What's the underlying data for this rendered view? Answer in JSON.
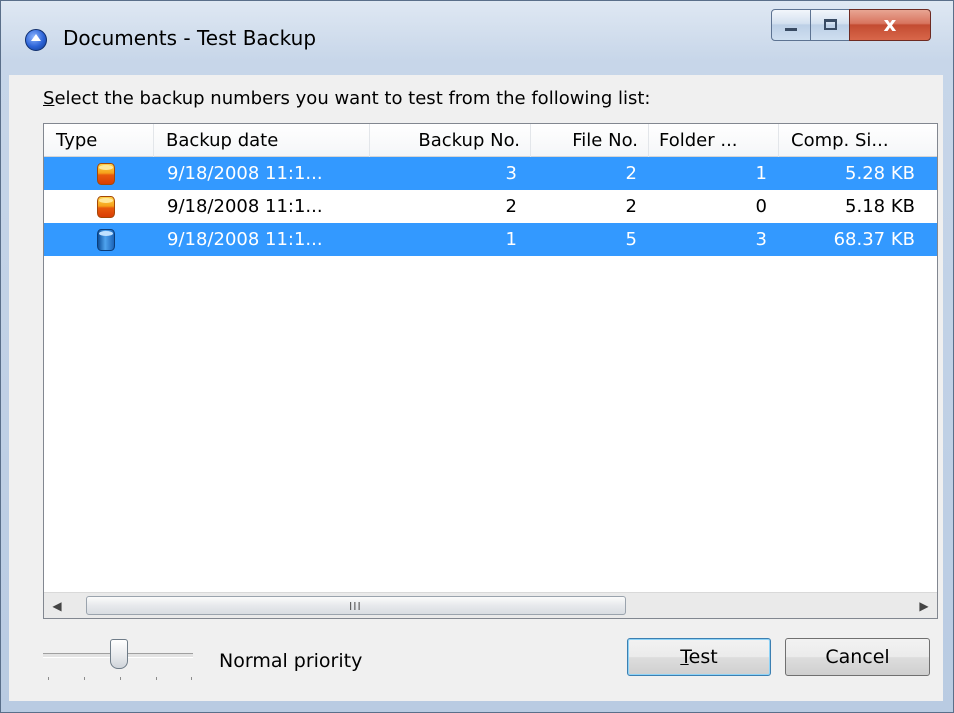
{
  "window": {
    "title": "Documents - Test Backup"
  },
  "instruction": {
    "underlined_char": "S",
    "rest": "elect the backup numbers you want to test from the following list:"
  },
  "columns": [
    "Type",
    "Backup date",
    "Backup No.",
    "File No.",
    "Folder ...",
    "Comp. Si..."
  ],
  "rows": [
    {
      "type_icon": "incremental-backup-icon",
      "date": "9/18/2008 11:1...",
      "backup_no": "3",
      "file_no": "2",
      "folder_no": "1",
      "comp_size": "5.28 KB",
      "selected": true
    },
    {
      "type_icon": "incremental-backup-icon",
      "date": "9/18/2008 11:1...",
      "backup_no": "2",
      "file_no": "2",
      "folder_no": "0",
      "comp_size": "5.18 KB",
      "selected": false
    },
    {
      "type_icon": "full-backup-icon",
      "date": "9/18/2008 11:1...",
      "backup_no": "1",
      "file_no": "5",
      "folder_no": "3",
      "comp_size": "68.37 KB",
      "selected": true
    }
  ],
  "scrollbar": {
    "grip": "III"
  },
  "priority": {
    "label": "Normal priority"
  },
  "buttons": {
    "test_underlined": "T",
    "test_rest": "est",
    "cancel": "Cancel"
  },
  "colors": {
    "selection": "#3399ff",
    "window_frame": "#c7d6e9",
    "close_button": "#c34b31"
  }
}
